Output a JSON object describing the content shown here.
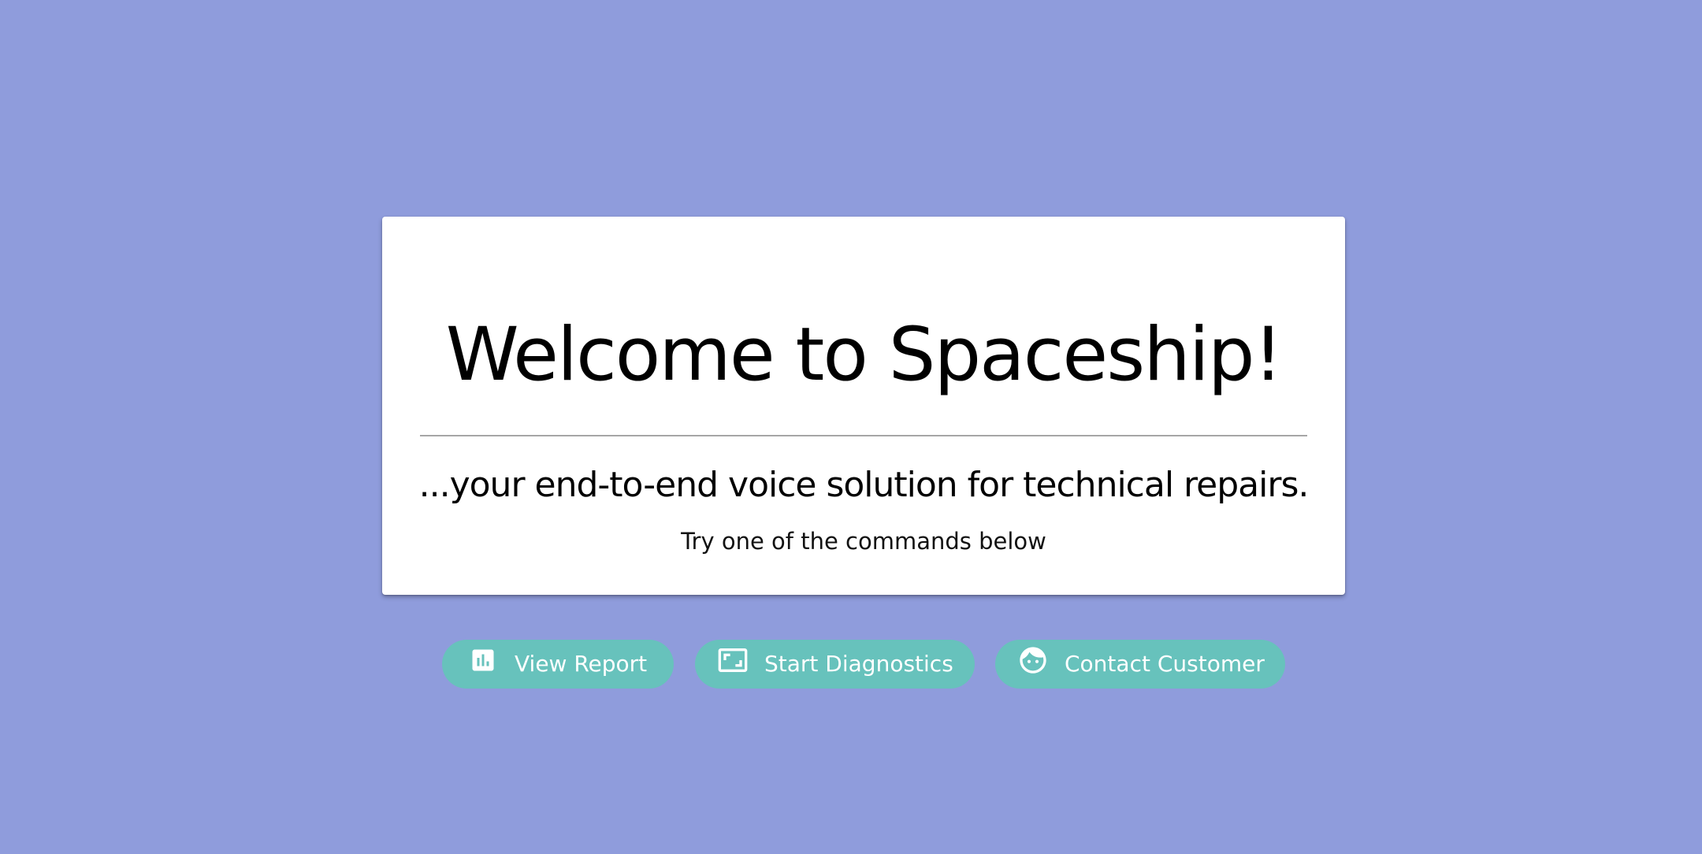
{
  "welcome": {
    "title": "Welcome to Spaceship!",
    "subtitle": "...your end-to-end voice solution for technical repairs.",
    "hint": "Try one of the commands below"
  },
  "commands": [
    {
      "label": "View Report",
      "icon": "bar-chart-icon"
    },
    {
      "label": "Start Diagnostics",
      "icon": "crop-frame-icon"
    },
    {
      "label": "Contact Customer",
      "icon": "face-icon"
    }
  ],
  "colors": {
    "background": "#8f9cdc",
    "card": "#ffffff",
    "button": "#67c2bc",
    "button_text": "#ffffff"
  }
}
